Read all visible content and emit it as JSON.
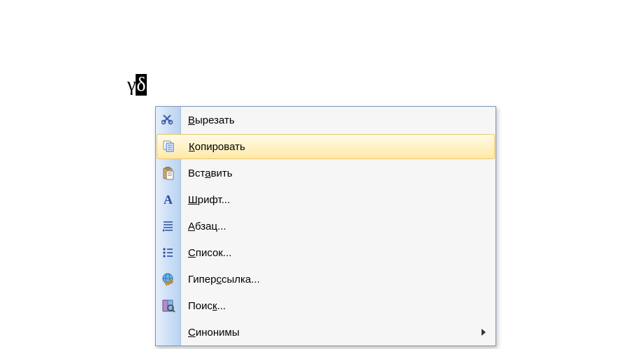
{
  "document": {
    "text_plain": "γ",
    "text_selected": "δ"
  },
  "context_menu": {
    "items": [
      {
        "id": "cut",
        "label": "Вырезать",
        "underline_index": 0,
        "icon": "scissors",
        "hovered": false,
        "submenu": false
      },
      {
        "id": "copy",
        "label": "Копировать",
        "underline_index": 0,
        "icon": "copy",
        "hovered": true,
        "submenu": false
      },
      {
        "id": "paste",
        "label": "Вставить",
        "underline_index": 3,
        "icon": "paste",
        "hovered": false,
        "submenu": false
      },
      {
        "id": "font",
        "label": "Шрифт...",
        "underline_index": 0,
        "icon": "font",
        "hovered": false,
        "submenu": false
      },
      {
        "id": "paragraph",
        "label": "Абзац...",
        "underline_index": 0,
        "icon": "paragraph",
        "hovered": false,
        "submenu": false
      },
      {
        "id": "list",
        "label": "Список...",
        "underline_index": 0,
        "icon": "list",
        "hovered": false,
        "submenu": false
      },
      {
        "id": "hyperlink",
        "label": "Гиперссылка...",
        "underline_index": 5,
        "icon": "hyperlink",
        "hovered": false,
        "submenu": false
      },
      {
        "id": "search",
        "label": "Поиск...",
        "underline_index": 4,
        "icon": "search",
        "hovered": false,
        "submenu": false
      },
      {
        "id": "synonyms",
        "label": "Синонимы",
        "underline_index": 0,
        "icon": "none",
        "hovered": false,
        "submenu": true
      }
    ]
  }
}
